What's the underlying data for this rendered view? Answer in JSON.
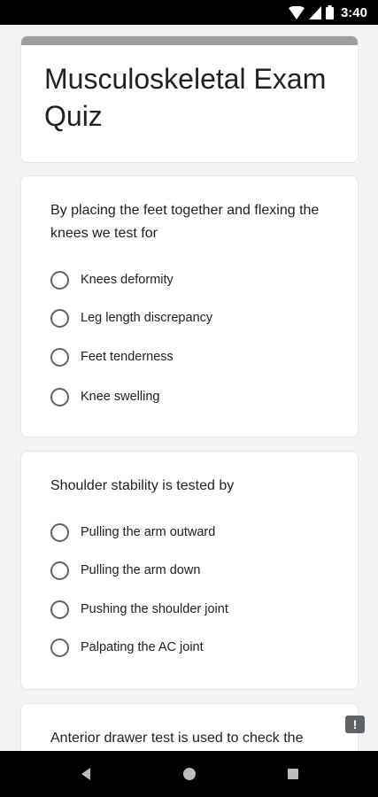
{
  "status": {
    "time": "3:40"
  },
  "form": {
    "title": "Musculoskeletal Exam Quiz"
  },
  "questions": [
    {
      "text": "By placing the feet together and flexing the knees we test for",
      "options": [
        "Knees deformity",
        "Leg length discrepancy",
        "Feet tenderness",
        "Knee swelling"
      ]
    },
    {
      "text": "Shoulder stability is tested by",
      "options": [
        "Pulling the arm outward",
        "Pulling the arm down",
        "Pushing the shoulder joint",
        "Palpating the AC joint"
      ]
    },
    {
      "text": "Anterior drawer test is used to check the"
    }
  ],
  "feedback": {
    "symbol": "!"
  },
  "colors": {
    "header_strip": "#9e9e9e",
    "background": "#f1f3f4",
    "radio_border": "#5f6368"
  }
}
